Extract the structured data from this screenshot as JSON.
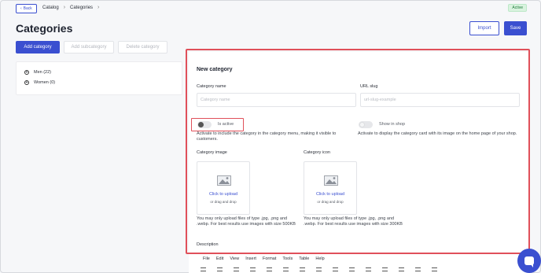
{
  "header": {
    "back_label": "Back",
    "breadcrumbs": [
      "Catalog",
      "Categories"
    ],
    "badge": "Active"
  },
  "page": {
    "title": "Categories",
    "import_label": "Import",
    "save_label": "Save"
  },
  "toolbar": {
    "add_category": "Add category",
    "add_subcategory": "Add subcategory",
    "delete_category": "Delete category"
  },
  "tree": {
    "items": [
      {
        "label": "Men (22)"
      },
      {
        "label": "Women (0)"
      }
    ]
  },
  "form": {
    "section_title": "New category",
    "category_name_label": "Category name",
    "category_name_placeholder": "Category name",
    "url_slug_label": "URL slug",
    "url_slug_placeholder": "url-slug-example",
    "is_active_label": "Is active",
    "is_active_help": "Activate to include the category in the category menu, making it visible to customers.",
    "show_in_shop_label": "Show in shop",
    "show_in_shop_help": "Activate to display the category card with its image on the home page of your shop.",
    "category_image_label": "Category image",
    "category_icon_label": "Category icon",
    "upload_click": "Click to upload",
    "upload_drag": "or drag and drop",
    "image_help": "You may only upload files of type .jpg, .png and .webp. For best results use images with size 500KB",
    "icon_help": "You may only upload files of type .jpg, .png and .webp. For best results use images with size 300KB",
    "description_label": "Description"
  },
  "editor": {
    "menu": [
      "File",
      "Edit",
      "View",
      "Insert",
      "Format",
      "Tools",
      "Table",
      "Help"
    ]
  },
  "colors": {
    "accent": "#3a4fd0",
    "highlight": "#e0505a",
    "badge_bg": "#d9f3df"
  }
}
